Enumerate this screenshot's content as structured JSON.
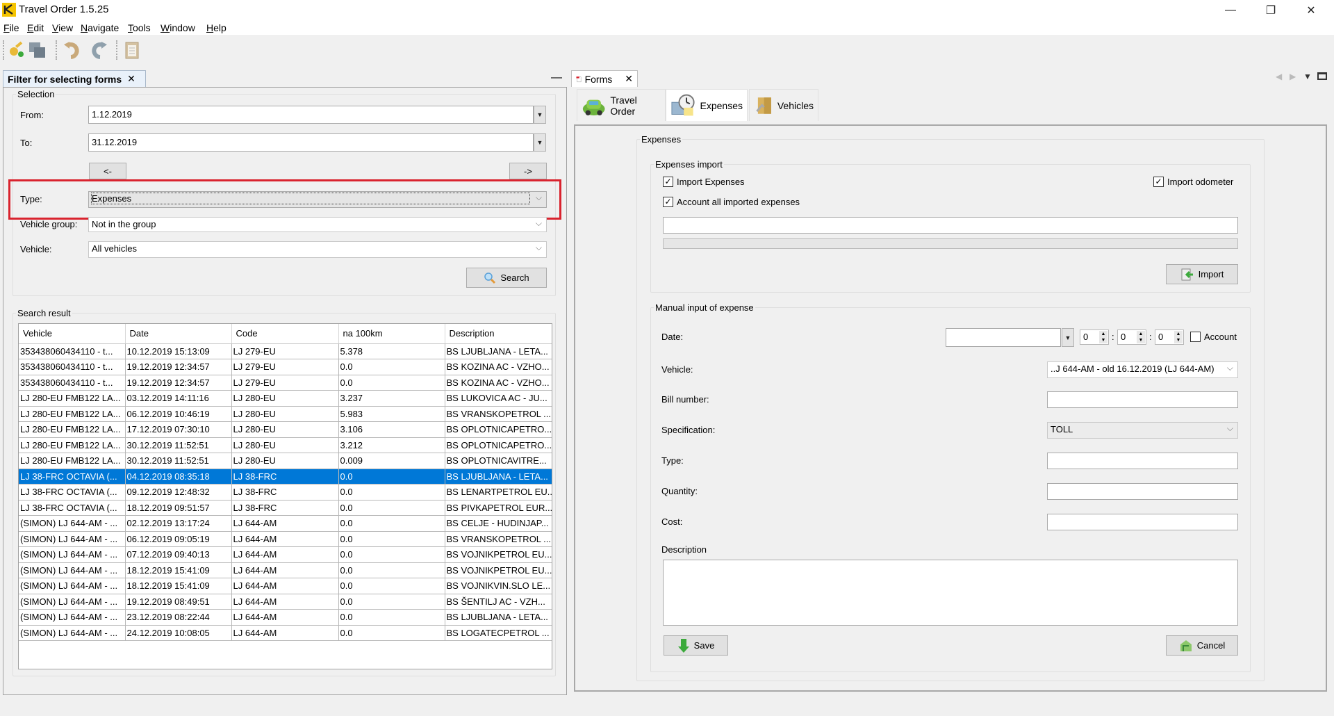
{
  "window": {
    "title": "Travel Order 1.5.25",
    "controls": {
      "minimize": "—",
      "restore": "❐",
      "close": "✕"
    }
  },
  "menu": [
    {
      "label": "File",
      "mnemonic": "F",
      "rest": "ile"
    },
    {
      "label": "Edit",
      "mnemonic": "E",
      "rest": "dit"
    },
    {
      "label": "View",
      "mnemonic": "V",
      "rest": "iew"
    },
    {
      "label": "Navigate",
      "mnemonic": "N",
      "rest": "avigate"
    },
    {
      "label": "Tools",
      "mnemonic": "T",
      "rest": "ools"
    },
    {
      "label": "Window",
      "mnemonic": "W",
      "rest": "indow"
    },
    {
      "label": "Help",
      "mnemonic": "H",
      "rest": "elp"
    }
  ],
  "toolbar": {
    "icons": [
      "key-add-icon",
      "save-all-icon",
      "undo-icon",
      "redo-icon",
      "clipboard-icon"
    ]
  },
  "left_panel": {
    "tab_label": "Filter for selecting forms",
    "tab_close": "✕",
    "minimize": "—",
    "selection": {
      "legend": "Selection",
      "from_label": "From:",
      "from_value": "1.12.2019",
      "to_label": "To:",
      "to_value": "31.12.2019",
      "prev_label": "<-",
      "next_label": "->",
      "type_label": "Type:",
      "type_value": "Expenses",
      "vehicle_group_label": "Vehicle group:",
      "vehicle_group_value": "Not in the group",
      "vehicle_label": "Vehicle:",
      "vehicle_value": "All vehicles",
      "search_label": "Search"
    },
    "results": {
      "legend": "Search result",
      "columns": [
        "Vehicle",
        "Date",
        "Code",
        "na 100km",
        "Description"
      ],
      "selected_index": 8,
      "rows": [
        [
          "353438060434110 - t...",
          "10.12.2019 15:13:09",
          "LJ 279-EU",
          "5.378",
          "BS LJUBLJANA - LETA..."
        ],
        [
          "353438060434110 - t...",
          "19.12.2019 12:34:57",
          "LJ 279-EU",
          "0.0",
          "BS KOZINA AC - VZHO..."
        ],
        [
          "353438060434110 - t...",
          "19.12.2019 12:34:57",
          "LJ 279-EU",
          "0.0",
          "BS KOZINA AC - VZHO..."
        ],
        [
          "LJ 280-EU  FMB122 LA...",
          "03.12.2019 14:11:16",
          "LJ 280-EU",
          "3.237",
          "BS LUKOVICA AC - JU..."
        ],
        [
          "LJ 280-EU  FMB122 LA...",
          "06.12.2019 10:46:19",
          "LJ 280-EU",
          "5.983",
          "BS VRANSKOPETROL ..."
        ],
        [
          "LJ 280-EU  FMB122 LA...",
          "17.12.2019 07:30:10",
          "LJ 280-EU",
          "3.106",
          "BS OPLOTNICAPETRO..."
        ],
        [
          "LJ 280-EU  FMB122 LA...",
          "30.12.2019 11:52:51",
          "LJ 280-EU",
          "3.212",
          "BS OPLOTNICAPETRO..."
        ],
        [
          "LJ 280-EU  FMB122 LA...",
          "30.12.2019 11:52:51",
          "LJ 280-EU",
          "0.009",
          "BS OPLOTNICAVITRE..."
        ],
        [
          "LJ 38-FRC OCTAVIA (...",
          "04.12.2019 08:35:18",
          "LJ 38-FRC",
          "0.0",
          "BS LJUBLJANA - LETA..."
        ],
        [
          "LJ 38-FRC OCTAVIA (...",
          "09.12.2019 12:48:32",
          "LJ 38-FRC",
          "0.0",
          "BS LENARTPETROL EU..."
        ],
        [
          "LJ 38-FRC OCTAVIA (...",
          "18.12.2019 09:51:57",
          "LJ 38-FRC",
          "0.0",
          "BS PIVKAPETROL EUR..."
        ],
        [
          "(SIMON) LJ 644-AM - ...",
          "02.12.2019 13:17:24",
          "LJ 644-AM",
          "0.0",
          "BS CELJE - HUDINJAP..."
        ],
        [
          "(SIMON) LJ 644-AM - ...",
          "06.12.2019 09:05:19",
          "LJ 644-AM",
          "0.0",
          "BS VRANSKOPETROL ..."
        ],
        [
          "(SIMON) LJ 644-AM - ...",
          "07.12.2019 09:40:13",
          "LJ 644-AM",
          "0.0",
          "BS VOJNIKPETROL EU..."
        ],
        [
          "(SIMON) LJ 644-AM - ...",
          "18.12.2019 15:41:09",
          "LJ 644-AM",
          "0.0",
          "BS VOJNIKPETROL EU..."
        ],
        [
          "(SIMON) LJ 644-AM - ...",
          "18.12.2019 15:41:09",
          "LJ 644-AM",
          "0.0",
          "BS VOJNIKVIN.SLO LE..."
        ],
        [
          "(SIMON) LJ 644-AM - ...",
          "19.12.2019 08:49:51",
          "LJ 644-AM",
          "0.0",
          "BS ŠENTILJ AC - VZH..."
        ],
        [
          "(SIMON) LJ 644-AM - ...",
          "23.12.2019 08:22:44",
          "LJ 644-AM",
          "0.0",
          "BS LJUBLJANA - LETA..."
        ],
        [
          "(SIMON) LJ 644-AM - ...",
          "24.12.2019 10:08:05",
          "LJ 644-AM",
          "0.0",
          "BS LOGATECPETROL ..."
        ]
      ]
    }
  },
  "right_panel": {
    "tab_label": "Forms",
    "tab_close": "✕",
    "subtabs": [
      {
        "label": "Travel Order",
        "icon": "car-icon",
        "active": false
      },
      {
        "label": "Expenses",
        "icon": "calculator-clock-icon",
        "active": true
      },
      {
        "label": "Vehicles",
        "icon": "folder-tools-icon",
        "active": false
      }
    ],
    "expenses": {
      "legend": "Expenses",
      "import": {
        "legend": "Expenses import",
        "import_expenses_label": "Import Expenses",
        "import_expenses_checked": true,
        "import_odometer_label": "Import odometer",
        "import_odometer_checked": true,
        "account_all_label": "Account all imported expenses",
        "account_all_checked": true,
        "file_value": "",
        "progress": 0,
        "import_button": "Import"
      },
      "manual": {
        "legend": "Manual input of expense",
        "date_label": "Date:",
        "date_value": "",
        "hour": "0",
        "minute": "0",
        "second": "0",
        "time_sep": ":",
        "account_label": "Account",
        "account_checked": false,
        "vehicle_label": "Vehicle:",
        "vehicle_value": "..J 644-AM - old 16.12.2019 (LJ 644-AM)",
        "bill_label": "Bill number:",
        "bill_value": "",
        "spec_label": "Specification:",
        "spec_value": "TOLL",
        "type_label": "Type:",
        "type_value": "",
        "quantity_label": "Quantity:",
        "quantity_value": "",
        "cost_label": "Cost:",
        "cost_value": "",
        "description_label": "Description",
        "description_value": "",
        "save_button": "Save",
        "cancel_button": "Cancel"
      }
    }
  },
  "colors": {
    "selection": "#0078d7",
    "highlight_box": "#d9232e"
  }
}
